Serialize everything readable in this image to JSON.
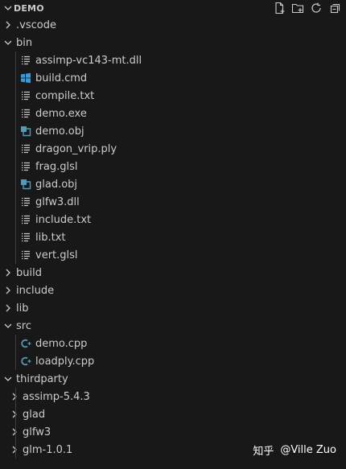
{
  "explorer": {
    "title": "DEMO",
    "actions": [
      "new-file-icon",
      "new-folder-icon",
      "refresh-icon",
      "collapse-all-icon"
    ]
  },
  "tree": [
    {
      "label": ".vscode",
      "type": "folder",
      "depth": 0,
      "expanded": false
    },
    {
      "label": "bin",
      "type": "folder",
      "depth": 0,
      "expanded": true
    },
    {
      "label": "assimp-vc143-mt.dll",
      "type": "file",
      "icon": "lines",
      "depth": 1
    },
    {
      "label": "build.cmd",
      "type": "file",
      "icon": "windows",
      "depth": 1
    },
    {
      "label": "compile.txt",
      "type": "file",
      "icon": "lines",
      "depth": 1
    },
    {
      "label": "demo.exe",
      "type": "file",
      "icon": "lines",
      "depth": 1
    },
    {
      "label": "demo.obj",
      "type": "file",
      "icon": "obj",
      "depth": 1
    },
    {
      "label": "dragon_vrip.ply",
      "type": "file",
      "icon": "lines",
      "depth": 1
    },
    {
      "label": "frag.glsl",
      "type": "file",
      "icon": "lines",
      "depth": 1
    },
    {
      "label": "glad.obj",
      "type": "file",
      "icon": "obj",
      "depth": 1
    },
    {
      "label": "glfw3.dll",
      "type": "file",
      "icon": "lines",
      "depth": 1
    },
    {
      "label": "include.txt",
      "type": "file",
      "icon": "lines",
      "depth": 1
    },
    {
      "label": "lib.txt",
      "type": "file",
      "icon": "lines",
      "depth": 1
    },
    {
      "label": "vert.glsl",
      "type": "file",
      "icon": "lines",
      "depth": 1
    },
    {
      "label": "build",
      "type": "folder",
      "depth": 0,
      "expanded": false
    },
    {
      "label": "include",
      "type": "folder",
      "depth": 0,
      "expanded": false
    },
    {
      "label": "lib",
      "type": "folder",
      "depth": 0,
      "expanded": false
    },
    {
      "label": "src",
      "type": "folder",
      "depth": 0,
      "expanded": true
    },
    {
      "label": "demo.cpp",
      "type": "file",
      "icon": "cpp",
      "depth": 1
    },
    {
      "label": "loadply.cpp",
      "type": "file",
      "icon": "cpp",
      "depth": 1
    },
    {
      "label": "thirdparty",
      "type": "folder",
      "depth": 0,
      "expanded": true
    },
    {
      "label": "assimp-5.4.3",
      "type": "folder",
      "depth": 1,
      "expanded": false
    },
    {
      "label": "glad",
      "type": "folder",
      "depth": 1,
      "expanded": false
    },
    {
      "label": "glfw3",
      "type": "folder",
      "depth": 1,
      "expanded": false
    },
    {
      "label": "glm-1.0.1",
      "type": "folder",
      "depth": 1,
      "expanded": false
    }
  ],
  "watermark": {
    "brand": "知乎",
    "author": "@Ville Zuo"
  },
  "colors": {
    "background": "#181818",
    "text": "#cccccc",
    "windows_icon": "#3c9bd7",
    "cpp_icon": "#519aba",
    "guide": "#3b3b3b"
  }
}
